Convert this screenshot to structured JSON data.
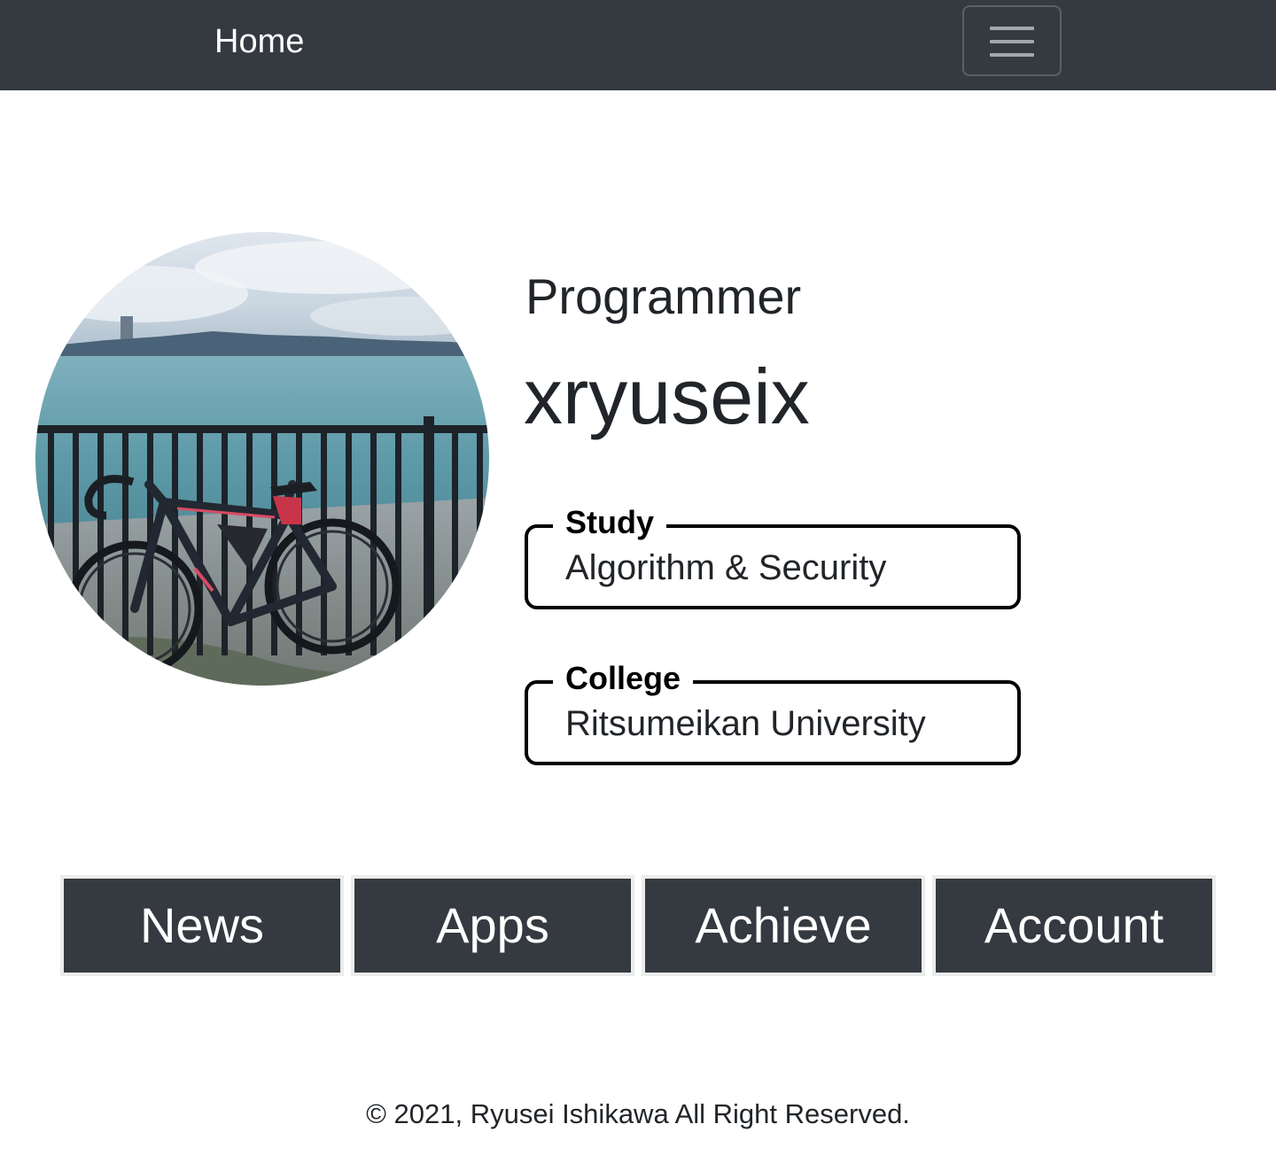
{
  "navbar": {
    "home_label": "Home",
    "toggler_icon": "hamburger-menu-icon",
    "background": "#343a40"
  },
  "profile": {
    "photo_description_icon": "bicycle-by-lake-photo",
    "role": "Programmer",
    "handle": "xryuseix",
    "study": {
      "label": "Study",
      "value": "Algorithm & Security"
    },
    "college": {
      "label": "College",
      "value": "Ritsumeikan University"
    }
  },
  "menu": {
    "buttons": [
      {
        "label": "News"
      },
      {
        "label": "Apps"
      },
      {
        "label": "Achieve"
      },
      {
        "label": "Account"
      }
    ]
  },
  "footer": {
    "text": "© 2021, Ryusei Ishikawa All Right Reserved."
  }
}
